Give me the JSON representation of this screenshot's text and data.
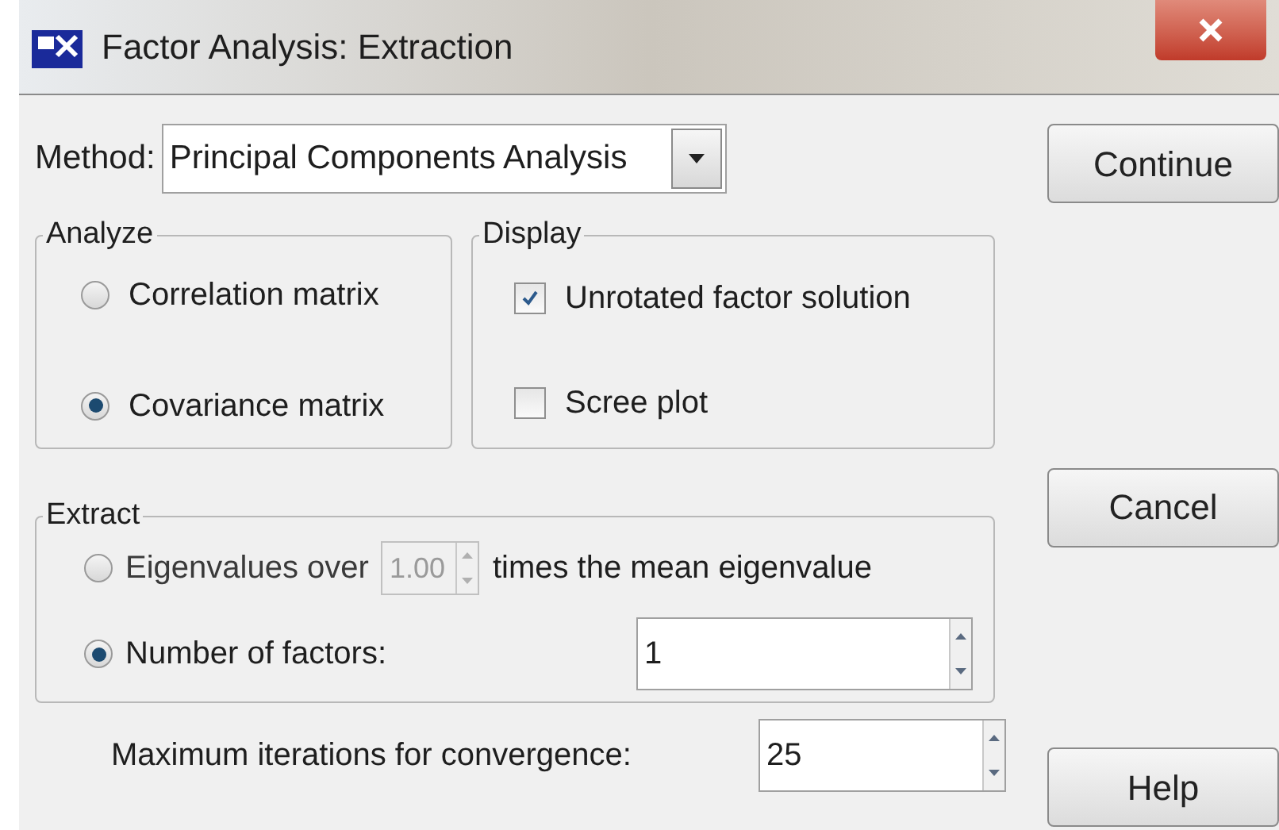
{
  "window": {
    "title": "Factor Analysis: Extraction"
  },
  "method": {
    "label": "Method:",
    "value": "Principal Components Analysis"
  },
  "analyze": {
    "title": "Analyze",
    "options": [
      {
        "label": "Correlation matrix",
        "selected": false
      },
      {
        "label": "Covariance matrix",
        "selected": true
      }
    ]
  },
  "display": {
    "title": "Display",
    "options": [
      {
        "label": "Unrotated factor solution",
        "checked": true
      },
      {
        "label": "Scree plot",
        "checked": false
      }
    ]
  },
  "extract": {
    "title": "Extract",
    "eigen": {
      "label": "Eigenvalues over",
      "value": "1.00",
      "suffix": "times the mean eigenvalue",
      "selected": false,
      "disabled": true
    },
    "factors": {
      "label": "Number of factors:",
      "value": "1",
      "selected": true,
      "disabled": false
    }
  },
  "iterations": {
    "label": "Maximum iterations for convergence:",
    "value": "25"
  },
  "buttons": [
    "Continue",
    "Cancel",
    "Help"
  ]
}
